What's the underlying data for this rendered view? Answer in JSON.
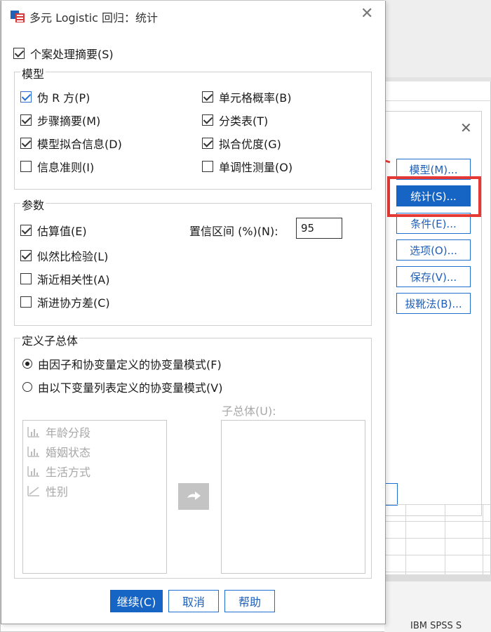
{
  "dialog": {
    "title": "多元 Logistic 回归：统计",
    "case_summary": {
      "label": "个案处理摘要(S)",
      "checked": true
    }
  },
  "model_group": {
    "label": "模型",
    "items": [
      {
        "label": "伪 R 方(P)",
        "checked": true
      },
      {
        "label": "步骤摘要(M)",
        "checked": true
      },
      {
        "label": "模型拟合信息(D)",
        "checked": true
      },
      {
        "label": "信息准则(I)",
        "checked": false
      },
      {
        "label": "单元格概率(B)",
        "checked": true
      },
      {
        "label": "分类表(T)",
        "checked": true
      },
      {
        "label": "拟合优度(G)",
        "checked": true
      },
      {
        "label": "单调性测量(O)",
        "checked": false
      }
    ]
  },
  "params_group": {
    "label": "参数",
    "items": [
      {
        "label": "估算值(E)",
        "checked": true
      },
      {
        "label": "似然比检验(L)",
        "checked": true
      },
      {
        "label": "渐近相关性(A)",
        "checked": false
      },
      {
        "label": "渐进协方差(C)",
        "checked": false
      }
    ],
    "ci_label": "置信区间 (%)(N):",
    "ci_value": "95"
  },
  "subpop_group": {
    "label": "定义子总体",
    "radio_options": [
      {
        "label": "由因子和协变量定义的协变量模式(F)",
        "selected": true
      },
      {
        "label": "由以下变量列表定义的协变量模式(V)",
        "selected": false
      }
    ],
    "variables": [
      "年龄分段",
      "婚姻状态",
      "生活方式",
      "性别"
    ],
    "subpop_label": "子总体(U):"
  },
  "buttons": {
    "continue": "继续(C)",
    "cancel": "取消",
    "help": "帮助"
  },
  "background_dialog": {
    "buttons": [
      "模型(M)...",
      "统计(S)...",
      "条件(E)...",
      "选项(O)...",
      "保存(V)...",
      "拔靴法(B)..."
    ],
    "active_button": "统计(S)...",
    "status_text": "IBM SPSS S"
  },
  "colors": {
    "accent": "#1665c4",
    "highlight": "#e53935"
  }
}
